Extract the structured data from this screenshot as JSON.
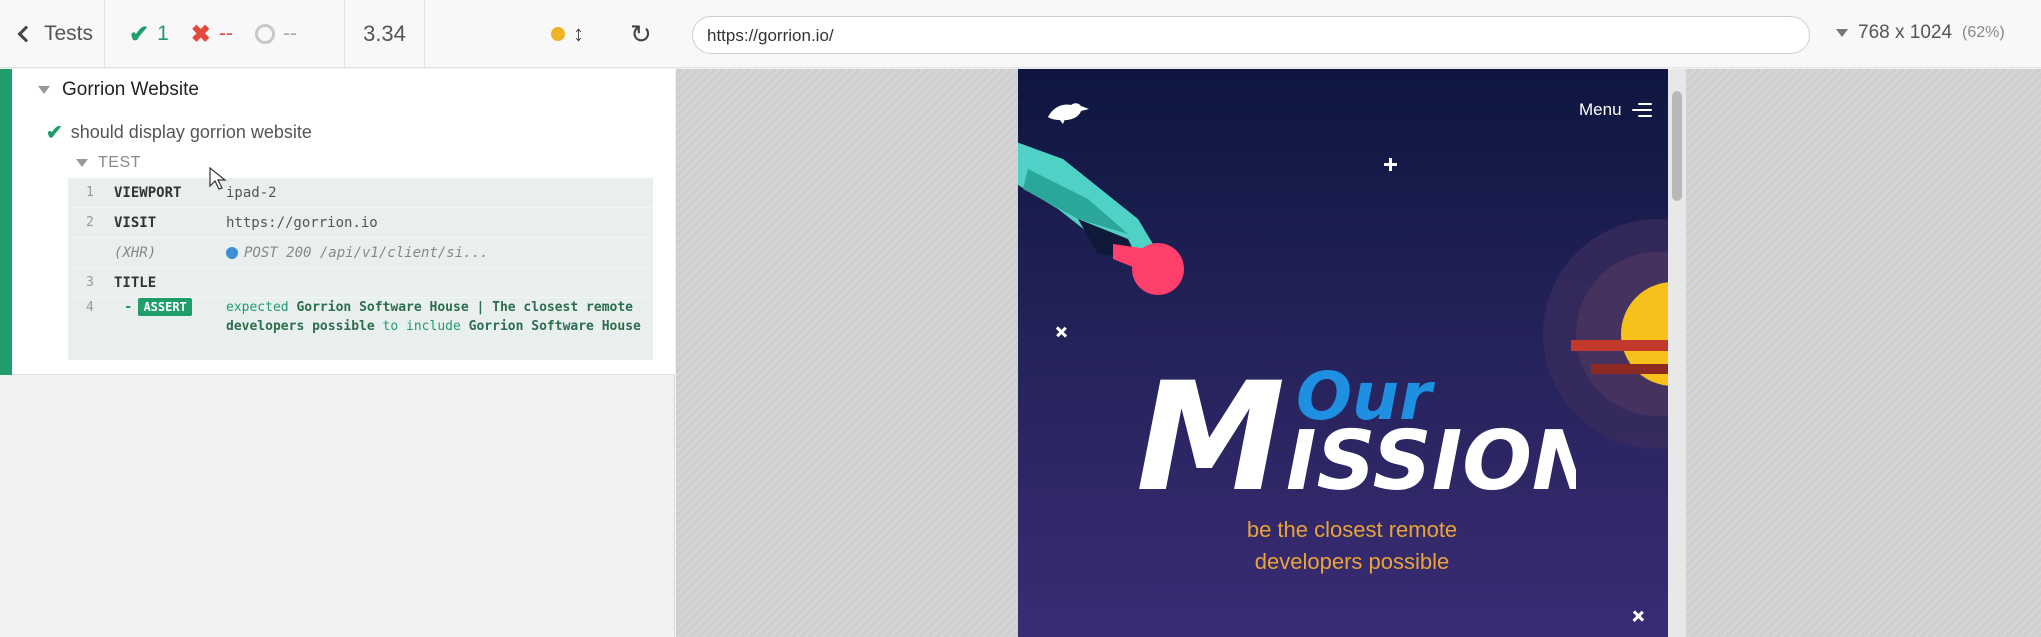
{
  "topbar": {
    "tests_label": "Tests",
    "passed": "1",
    "failed": "--",
    "pending": "--",
    "duration": "3.34",
    "url": "https://gorrion.io/",
    "viewport": "768 x 1024",
    "scale": "(62%)"
  },
  "reporter": {
    "suite_title": "Gorrion Website",
    "test_title": "should display gorrion website",
    "section_label": "TEST",
    "commands": [
      {
        "num": "1",
        "name": "VIEWPORT",
        "message": "ipad-2"
      },
      {
        "num": "2",
        "name": "VISIT",
        "message": "https://gorrion.io"
      },
      {
        "num": "",
        "name": "(XHR)",
        "message": "POST 200 /api/v1/client/si..."
      },
      {
        "num": "3",
        "name": "TITLE",
        "message": ""
      },
      {
        "num": "4",
        "name": "ASSERT",
        "message_parts": [
          "expected",
          "Gorrion Software House | The closest remote developers possible",
          "to include",
          "Gorrion Software House"
        ]
      }
    ]
  },
  "site": {
    "menu_label": "Menu",
    "heading_top": "Our",
    "heading_main_m": "M",
    "heading_main_rest": "ISSION",
    "subtitle_line1": "be the closest remote",
    "subtitle_line2": "developers possible"
  },
  "colors": {
    "pass": "#1f9d6b",
    "fail": "#e24a3b",
    "running_dot": "#f0b323",
    "site_heading_accent": "#1e8fe1",
    "site_subtitle": "#e8a33a"
  }
}
